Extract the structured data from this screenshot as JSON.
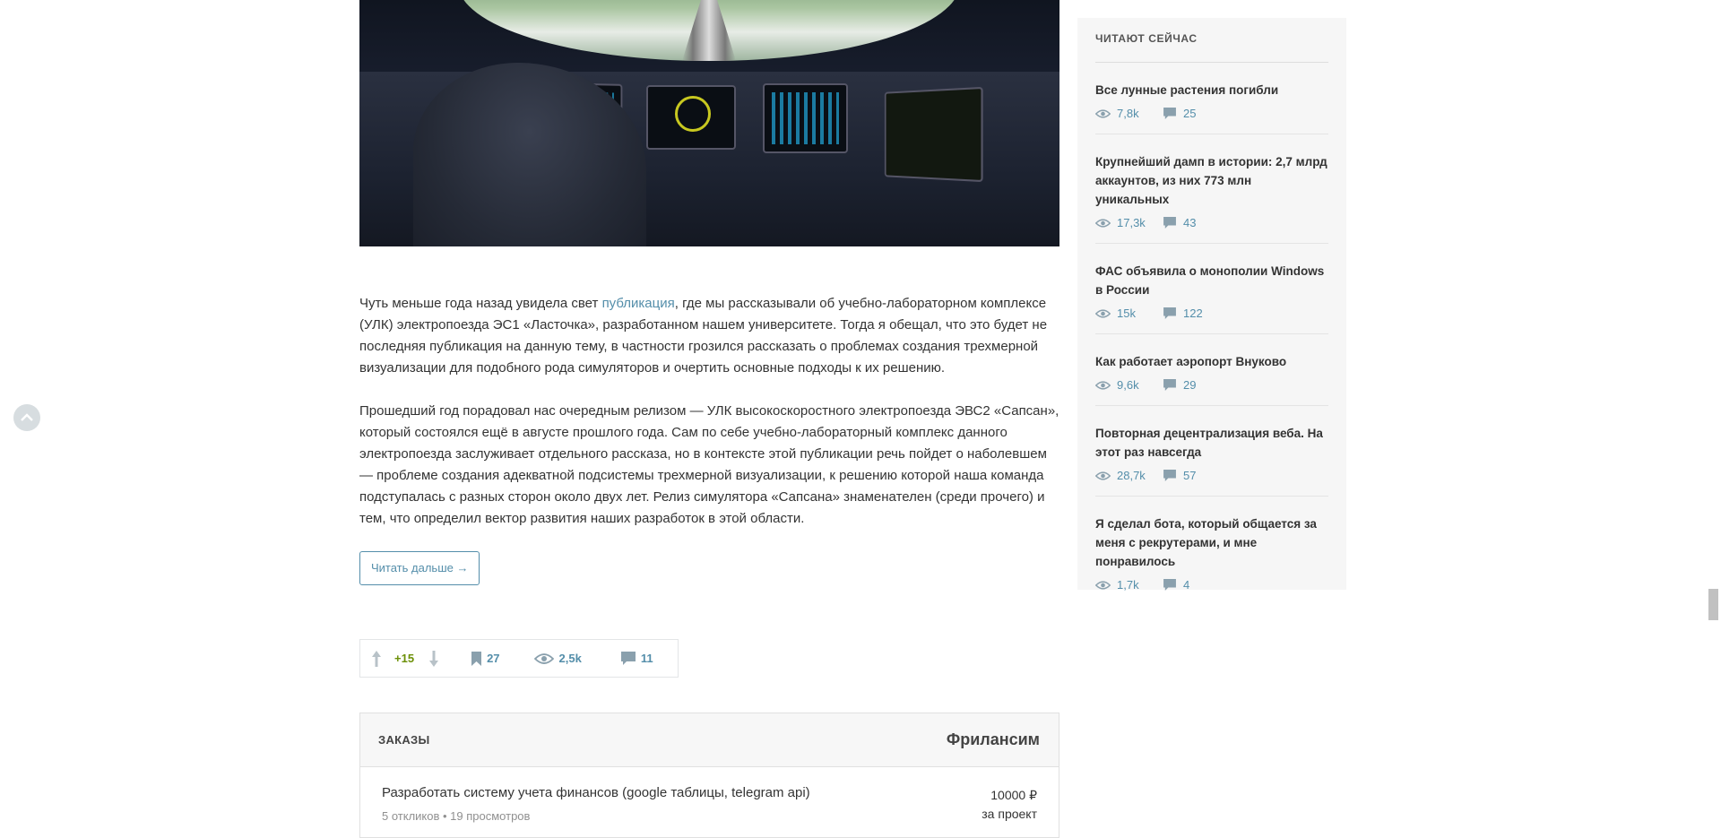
{
  "article": {
    "paragraph1_before_link": "Чуть меньше года назад увидела свет ",
    "paragraph1_link": "публикация",
    "paragraph1_after_link": ", где мы рассказывали об учебно-лабораторном комплексе (УЛК) электропоезда ЭС1 «Ласточка», разработанном нашем университете. Тогда я обещал, что это будет не последняя публикация на данную тему, в частности грозился рассказать о проблемах создания трехмерной визуализации для подобного рода симуляторов и очертить основные подходы к их решению.",
    "paragraph2": "Прошедший год порадовал нас очередным релизом — УЛК высокоскоростного электропоезда ЭВС2 «Сапсан», который состоялся ещё в августе прошлого года. Сам по себе учебно-лабораторный комплекс данного электропоезда заслуживает отдельного рассказа, но в контексте этой публикации речь пойдет о наболевшем — проблеме создания адекватной подсистемы трехмерной визуализации, к решению которой наша команда подступалась с разных сторон около двух лет. Релиз симулятора «Сапсана» знаменателен (среди прочего) и тем, что определил вектор развития наших разработок в этой области.",
    "read_more": "Читать дальше →"
  },
  "stats": {
    "rating": "+15",
    "bookmarks": "27",
    "views": "2,5k",
    "comments": "11"
  },
  "orders": {
    "title": "ЗАКАЗЫ",
    "brand": "Фрилансим",
    "items": [
      {
        "name": "Разработать систему учета финансов (google таблицы, telegram api)",
        "meta": "5 откликов • 19 просмотров",
        "price": "10000 ₽",
        "price_unit": "за проект"
      }
    ]
  },
  "sidebar": {
    "title": "ЧИТАЮТ СЕЙЧАС",
    "items": [
      {
        "title": "Все лунные растения погибли",
        "views": "7,8k",
        "comments": "25"
      },
      {
        "title": "Крупнейший дамп в истории: 2,7 млрд аккаунтов, из них 773 млн уникальных",
        "views": "17,3k",
        "comments": "43"
      },
      {
        "title": "ФАС объявила о монополии Windows в России",
        "views": "15k",
        "comments": "122"
      },
      {
        "title": "Как работает аэропорт Внуково",
        "views": "9,6k",
        "comments": "29"
      },
      {
        "title": "Повторная децентрализация веба. На этот раз навсегда",
        "views": "28,7k",
        "comments": "57"
      },
      {
        "title": "Я сделал бота, который общается за меня с рекрутерами, и мне понравилось",
        "views": "1,7k",
        "comments": "4"
      }
    ]
  },
  "colors": {
    "link": "#548eaa",
    "vote_positive": "#6c9007",
    "sidebar_bg": "#f6f6f6"
  },
  "icons": [
    "chevron-up-icon",
    "arrow-up-icon",
    "arrow-down-icon",
    "bookmark-icon",
    "eye-icon",
    "comment-icon"
  ]
}
